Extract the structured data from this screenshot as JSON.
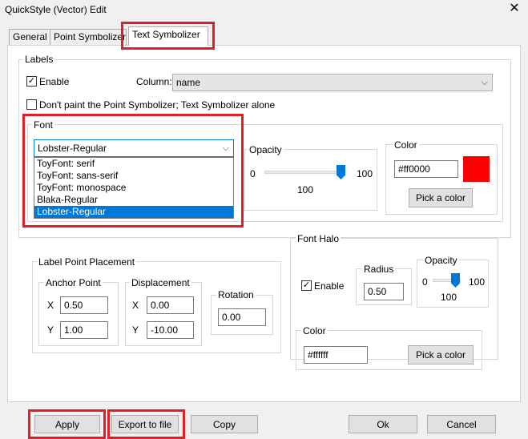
{
  "window": {
    "title": "QuickStyle (Vector) Edit",
    "close_glyph": "✕"
  },
  "tabs": [
    {
      "label": "General"
    },
    {
      "label": "Point Symbolizer"
    },
    {
      "label": "Text Symbolizer",
      "active": true
    }
  ],
  "labels": {
    "group_title": "Labels",
    "enable_label": "Enable",
    "enable_checked": true,
    "column_label": "Column:",
    "column_value": "name",
    "dont_paint_label": "Don't paint the Point Symbolizer; Text Symbolizer alone",
    "dont_paint_checked": false
  },
  "font": {
    "group_title": "Font",
    "selected": "Lobster-Regular",
    "options": [
      "ToyFont: serif",
      "ToyFont: sans-serif",
      "ToyFont: monospace",
      "Blaka-Regular",
      "Lobster-Regular"
    ]
  },
  "opacity": {
    "group_title": "Opacity",
    "min": "0",
    "max": "100",
    "value": "100",
    "level": 1.0
  },
  "color": {
    "group_title": "Color",
    "hex": "#ff0000",
    "swatch": "#ff0000",
    "pick_label": "Pick a color"
  },
  "placement": {
    "group_title": "Label Point Placement",
    "anchor": {
      "title": "Anchor Point",
      "x_label": "X",
      "x": "0.50",
      "y_label": "Y",
      "y": "1.00"
    },
    "displacement": {
      "title": "Displacement",
      "x_label": "X",
      "x": "0.00",
      "y_label": "Y",
      "y": "-10.00"
    },
    "rotation": {
      "title": "Rotation",
      "value": "0.00"
    }
  },
  "halo": {
    "group_title": "Font Halo",
    "enable_label": "Enable",
    "enable_checked": true,
    "radius_title": "Radius",
    "radius": "0.50",
    "opacity_title": "Opacity",
    "opacity_min": "0",
    "opacity_max": "100",
    "opacity_value": "100",
    "opacity_level": 1.0,
    "color_title": "Color",
    "color_hex": "#ffffff",
    "pick_label": "Pick a color"
  },
  "footer": {
    "apply": "Apply",
    "export": "Export to file",
    "copy": "Copy",
    "ok": "Ok",
    "cancel": "Cancel"
  },
  "annotation_color": "#e02026"
}
